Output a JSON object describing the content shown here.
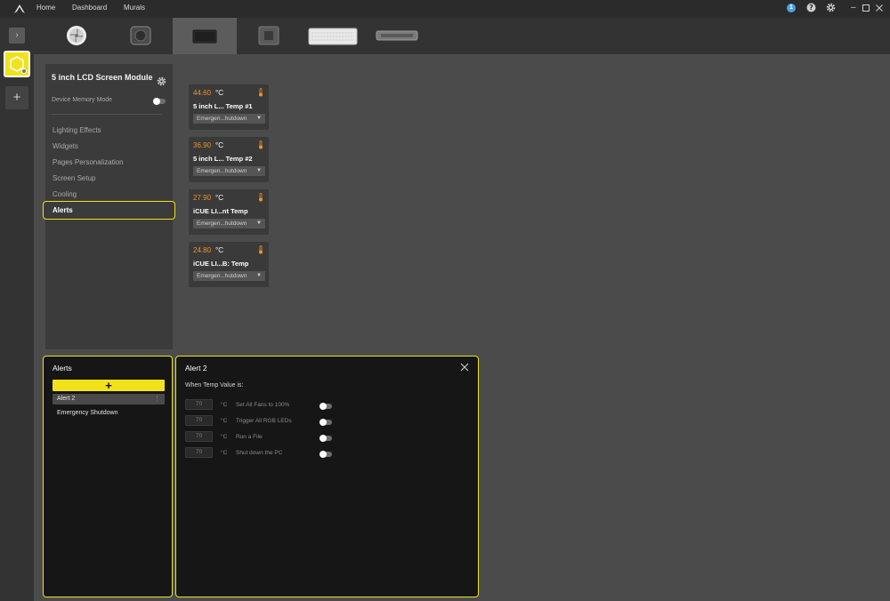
{
  "nav": {
    "home": "Home",
    "dashboard": "Dashboard",
    "murals": "Murals"
  },
  "topbar": {
    "notification_count": "1"
  },
  "devices": [
    {
      "name": "fan-device"
    },
    {
      "name": "pump-device"
    },
    {
      "name": "lcd-screen-device"
    },
    {
      "name": "controller-device"
    },
    {
      "name": "keyboard-device"
    },
    {
      "name": "hub-device"
    }
  ],
  "settings": {
    "device_title": "5 inch LCD Screen Module",
    "memory_mode_label": "Device Memory Mode",
    "menu": {
      "lighting": "Lighting Effects",
      "widgets": "Widgets",
      "pages": "Pages Personalization",
      "screen": "Screen Setup",
      "cooling": "Cooling",
      "alerts": "Alerts"
    }
  },
  "sensors": [
    {
      "value": "44.60",
      "unit": "°C",
      "name": "5 inch L... Temp #1",
      "action": "Emergen...hutdown"
    },
    {
      "value": "36.90",
      "unit": "°C",
      "name": "5 inch L... Temp #2",
      "action": "Emergen...hutdown"
    },
    {
      "value": "27.90",
      "unit": "°C",
      "name": "iCUE LI...nt Temp",
      "action": "Emergen...hutdown"
    },
    {
      "value": "24.80",
      "unit": "°C",
      "name": "iCUE LI...B: Temp",
      "action": "Emergen...hutdown"
    }
  ],
  "alerts_panel": {
    "title": "Alerts",
    "add_label": "+",
    "items": [
      "Alert 2",
      "Emergency Shutdown"
    ]
  },
  "alert_detail": {
    "title": "Alert 2",
    "when_label": "When Temp Value is:",
    "rules": [
      {
        "value": "70",
        "unit": "°C",
        "label": "Set All Fans to 100%"
      },
      {
        "value": "70",
        "unit": "°C",
        "label": "Trigger All RGB LEDs"
      },
      {
        "value": "70",
        "unit": "°C",
        "label": "Run a File"
      },
      {
        "value": "70",
        "unit": "°C",
        "label": "Shut down the PC"
      }
    ]
  },
  "colors": {
    "accent": "#f2e21b",
    "temp_value": "#f0922c",
    "notification": "#4ea1e8"
  }
}
